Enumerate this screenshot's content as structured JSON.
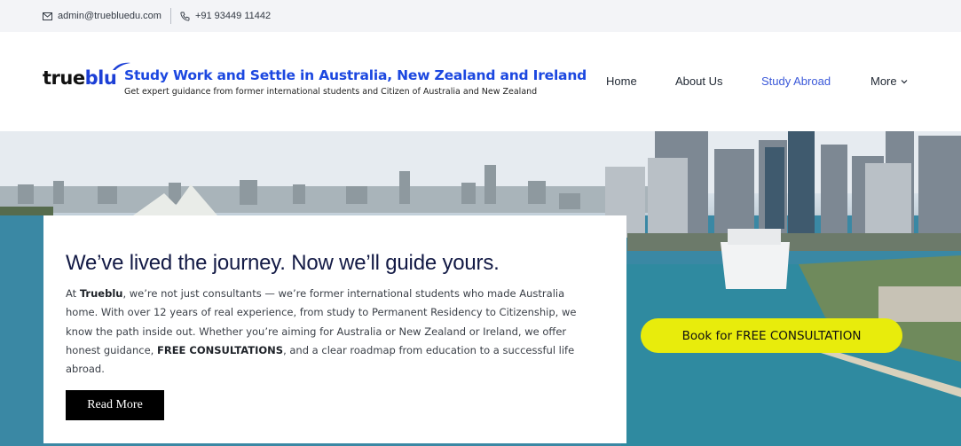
{
  "topbar": {
    "email": "admin@truebluedu.com",
    "phone": "+91 93449 11442",
    "email_icon": "mail-icon",
    "phone_icon": "phone-icon"
  },
  "brand": {
    "logo_part1": "true",
    "logo_part2": "blu",
    "headline": "Study Work and Settle in Australia, New Zealand and Ireland",
    "subline": "Get expert guidance from former international students and Citizen of Australia and New Zealand",
    "accent_color": "#1c48e0"
  },
  "nav": {
    "items": [
      {
        "label": "Home"
      },
      {
        "label": "About Us"
      },
      {
        "label": "Study Abroad"
      },
      {
        "label": "More"
      }
    ],
    "active_color": "#3b59d9"
  },
  "hero": {
    "card_heading": "We’ve lived the journey. Now we’ll guide yours.",
    "p1_a": "At ",
    "p1_brand": "Trueblu",
    "p1_b": ", we’re not just consultants — we’re former international students who made Australia home. With over 12 years of real experience, from study to Permanent Residency to Citizenship, we know the path inside out. Whether you’re aiming for Australia or New Zealand or Ireland, we offer honest guidance, ",
    "p1_bold": "FREE CONSULTATIONS",
    "p1_c": ", and a clear roadmap from education to a successful life abroad.",
    "read_more_label": "Read More",
    "consult_label": "Book for FREE CONSULTATION",
    "consult_color": "#e8ec0c"
  }
}
